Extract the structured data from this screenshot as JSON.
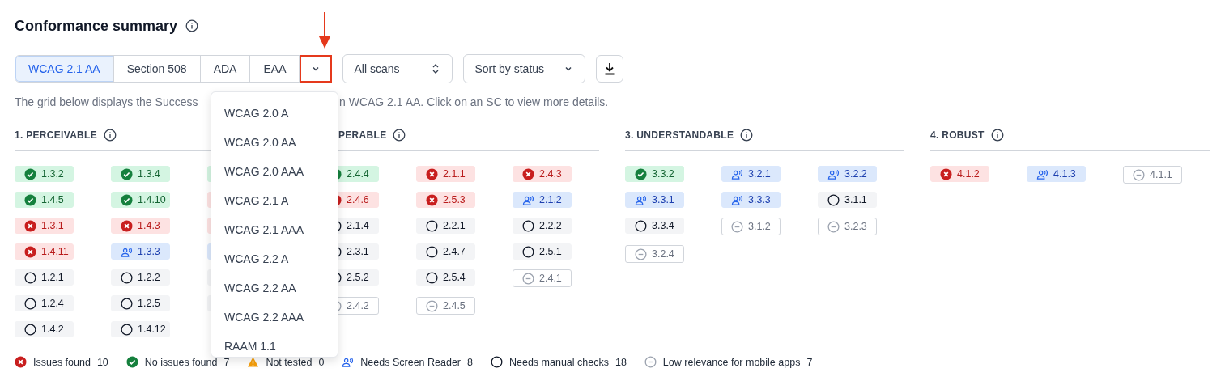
{
  "title": "Conformance summary",
  "standards": [
    {
      "label": "WCAG 2.1 AA",
      "selected": true
    },
    {
      "label": "Section 508",
      "selected": false
    },
    {
      "label": "ADA",
      "selected": false
    },
    {
      "label": "EAA",
      "selected": false
    }
  ],
  "more_button": {
    "highlighted": true
  },
  "scan_select": {
    "value": "All scans"
  },
  "sort_select": {
    "value": "Sort by status"
  },
  "description": [
    "The grid below displays the Success",
    "n WCAG 2.1 AA. Click on an SC to view more details."
  ],
  "groups": [
    {
      "title": "1. PERCEIVABLE",
      "items": [
        {
          "kind": "pass",
          "label": "1.3.2"
        },
        {
          "kind": "pass",
          "label": "1.3.4"
        },
        {
          "kind": "pass"
        },
        {
          "kind": "pass",
          "label": "1.4.5"
        },
        {
          "kind": "pass",
          "label": "1.4.10"
        },
        {
          "kind": "fail"
        },
        {
          "kind": "fail",
          "label": "1.3.1"
        },
        {
          "kind": "fail",
          "label": "1.4.3"
        },
        {
          "kind": "fail"
        },
        {
          "kind": "fail",
          "label": "1.4.11"
        },
        {
          "kind": "reader",
          "label": "1.3.3"
        },
        {
          "kind": "reader"
        },
        {
          "kind": "manual",
          "label": "1.2.1"
        },
        {
          "kind": "manual",
          "label": "1.2.2"
        },
        {
          "kind": "manual"
        },
        {
          "kind": "manual",
          "label": "1.2.4"
        },
        {
          "kind": "manual",
          "label": "1.2.5"
        },
        {
          "kind": "manual"
        },
        {
          "kind": "manual",
          "label": "1.4.2"
        },
        {
          "kind": "manual",
          "label": "1.4.12"
        }
      ]
    },
    {
      "title": "PERABLE",
      "items": [
        {
          "kind": "pass",
          "label": "2.4.4"
        },
        {
          "kind": "fail",
          "label": "2.1.1"
        },
        {
          "kind": "fail",
          "label": "2.4.3"
        },
        {
          "kind": "fail",
          "label": "2.4.6"
        },
        {
          "kind": "fail",
          "label": "2.5.3"
        },
        {
          "kind": "reader",
          "label": "2.1.2"
        },
        {
          "kind": "manual",
          "label": "2.1.4"
        },
        {
          "kind": "manual",
          "label": "2.2.1"
        },
        {
          "kind": "manual",
          "label": "2.2.2"
        },
        {
          "kind": "manual",
          "label": "2.3.1"
        },
        {
          "kind": "manual",
          "label": "2.4.7"
        },
        {
          "kind": "manual",
          "label": "2.5.1"
        },
        {
          "kind": "manual",
          "label": "2.5.2"
        },
        {
          "kind": "manual",
          "label": "2.5.4"
        },
        {
          "kind": "low",
          "label": "2.4.1"
        },
        {
          "kind": "low",
          "label": "2.4.2"
        },
        {
          "kind": "low",
          "label": "2.4.5"
        }
      ]
    },
    {
      "title": "3. UNDERSTANDABLE",
      "items": [
        {
          "kind": "pass",
          "label": "3.3.2"
        },
        {
          "kind": "reader",
          "label": "3.2.1"
        },
        {
          "kind": "reader",
          "label": "3.2.2"
        },
        {
          "kind": "reader",
          "label": "3.3.1"
        },
        {
          "kind": "reader",
          "label": "3.3.3"
        },
        {
          "kind": "manual",
          "label": "3.1.1"
        },
        {
          "kind": "manual",
          "label": "3.3.4"
        },
        {
          "kind": "low",
          "label": "3.1.2"
        },
        {
          "kind": "low",
          "label": "3.2.3"
        },
        {
          "kind": "low",
          "label": "3.2.4"
        }
      ]
    },
    {
      "title": "4. ROBUST",
      "items": [
        {
          "kind": "fail",
          "label": "4.1.2"
        },
        {
          "kind": "reader",
          "label": "4.1.3"
        },
        {
          "kind": "low",
          "label": "4.1.1"
        }
      ]
    }
  ],
  "dropdown": [
    "WCAG 2.0 A",
    "WCAG 2.0 AA",
    "WCAG 2.0 AAA",
    "WCAG 2.1 A",
    "WCAG 2.1 AAA",
    "WCAG 2.2 A",
    "WCAG 2.2 AA",
    "WCAG 2.2 AAA",
    "RAAM 1.1"
  ],
  "legend": [
    {
      "kind": "fail",
      "label": "Issues found",
      "count": "10"
    },
    {
      "kind": "pass",
      "label": "No issues found",
      "count": "7"
    },
    {
      "kind": "untested",
      "label": "Not tested",
      "count": "0"
    },
    {
      "kind": "reader",
      "label": "Needs Screen Reader",
      "count": "8"
    },
    {
      "kind": "manual",
      "label": "Needs manual checks",
      "count": "18"
    },
    {
      "kind": "low",
      "label": "Low relevance for mobile apps",
      "count": "7"
    }
  ]
}
